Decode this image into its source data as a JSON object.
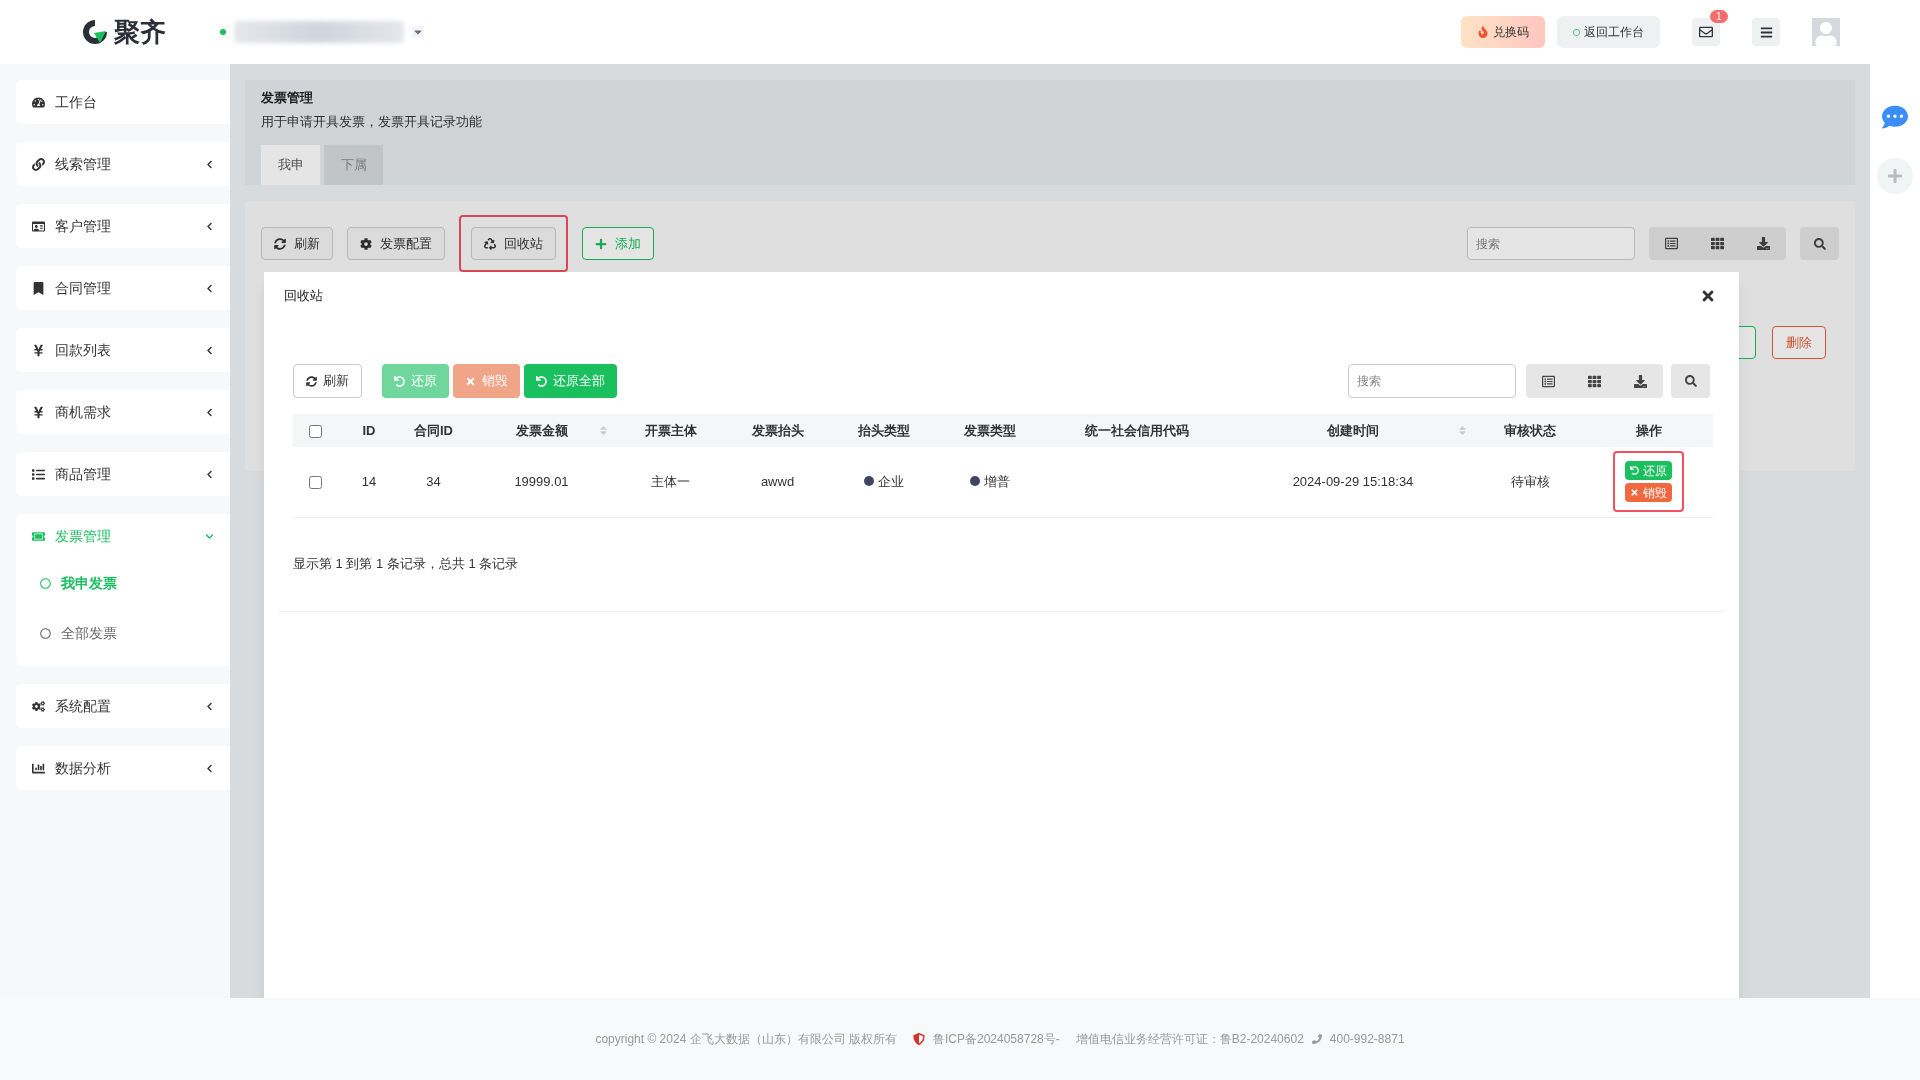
{
  "brand": {
    "name": "聚齐"
  },
  "topbar": {
    "buttons": [
      {
        "kind": "redeem",
        "label": "兑换码"
      },
      {
        "kind": "workbench",
        "label": "返回工作台"
      }
    ],
    "mail_badge": "1"
  },
  "sidebar": {
    "items": [
      {
        "label": "工作台",
        "expandable": false,
        "expanded": false,
        "selected": false
      },
      {
        "label": "线索管理",
        "expandable": true,
        "expanded": false,
        "selected": false
      },
      {
        "label": "客户管理",
        "expandable": true,
        "expanded": false,
        "selected": false
      },
      {
        "label": "合同管理",
        "expandable": true,
        "expanded": false,
        "selected": false
      },
      {
        "label": "回款列表",
        "expandable": true,
        "expanded": false,
        "selected": false
      },
      {
        "label": "商机需求",
        "expandable": true,
        "expanded": false,
        "selected": false
      },
      {
        "label": "商品管理",
        "expandable": true,
        "expanded": false,
        "selected": false
      },
      {
        "label": "发票管理",
        "expandable": true,
        "expanded": true,
        "selected": true,
        "children": [
          {
            "label": "我申发票",
            "selected": true
          },
          {
            "label": "全部发票",
            "selected": false
          }
        ]
      },
      {
        "label": "系统配置",
        "expandable": true,
        "expanded": false,
        "selected": false
      },
      {
        "label": "数据分析",
        "expandable": true,
        "expanded": false,
        "selected": false
      }
    ]
  },
  "page": {
    "title": "发票管理",
    "description": "用于申请开具发票，发票开具记录功能",
    "tabs": [
      {
        "label": "我申",
        "selected": true
      },
      {
        "label": "下属",
        "selected": false
      }
    ],
    "toolbar": [
      {
        "kind": "refresh",
        "label": "刷新",
        "highlighted": false
      },
      {
        "kind": "config",
        "label": "发票配置",
        "highlighted": false
      },
      {
        "kind": "recycle",
        "label": "回收站",
        "highlighted": true
      },
      {
        "kind": "add",
        "label": "添加",
        "highlighted": false
      }
    ],
    "search": {
      "placeholder": "搜索"
    },
    "delete_button": "删除"
  },
  "modal": {
    "title": "回收站",
    "toolbar": [
      {
        "kind": "refresh",
        "label": "刷新",
        "disabled": false
      },
      {
        "kind": "restore",
        "label": "还原",
        "disabled": true
      },
      {
        "kind": "destroy",
        "label": "销毁",
        "disabled": true
      },
      {
        "kind": "restore",
        "label": "还原全部",
        "disabled": false
      }
    ],
    "search": {
      "placeholder": "搜索"
    },
    "table": {
      "select_all_checked": false,
      "columns": [
        {
          "label": "ID",
          "sortable": false
        },
        {
          "label": "合同ID",
          "sortable": false
        },
        {
          "label": "发票金额",
          "sortable": true
        },
        {
          "label": "开票主体",
          "sortable": false
        },
        {
          "label": "发票抬头",
          "sortable": false
        },
        {
          "label": "抬头类型",
          "sortable": false
        },
        {
          "label": "发票类型",
          "sortable": false
        },
        {
          "label": "统一社会信用代码",
          "sortable": false
        },
        {
          "label": "创建时间",
          "sortable": true
        },
        {
          "label": "审核状态",
          "sortable": false
        },
        {
          "label": "操作",
          "sortable": false
        }
      ],
      "rows": [
        {
          "checked": false,
          "id": "14",
          "contract_id": "34",
          "amount": "19999.01",
          "issuer": "主体一",
          "invoice_title": "awwd",
          "title_type": {
            "text": "企业",
            "color": "#3f4563"
          },
          "invoice_type": {
            "text": "增普",
            "color": "#3f4563"
          },
          "created_at": "2024-09-29 15:18:34",
          "status": "待审核",
          "actions_highlighted": true,
          "actions": [
            {
              "kind": "restore",
              "label": "还原"
            },
            {
              "kind": "destroy",
              "label": "销毁"
            }
          ]
        }
      ]
    },
    "pagination": "显示第 1 到第 1 条记录，总共 1 条记录"
  },
  "footer": {
    "copyright": "copyright © 2024 企飞大数据（山东）有限公司 版权所有",
    "icp": "鲁ICP备2024058728号-",
    "license": "增值电信业务经营许可证：鲁B2-20240602",
    "phone": "400-992-8871"
  }
}
